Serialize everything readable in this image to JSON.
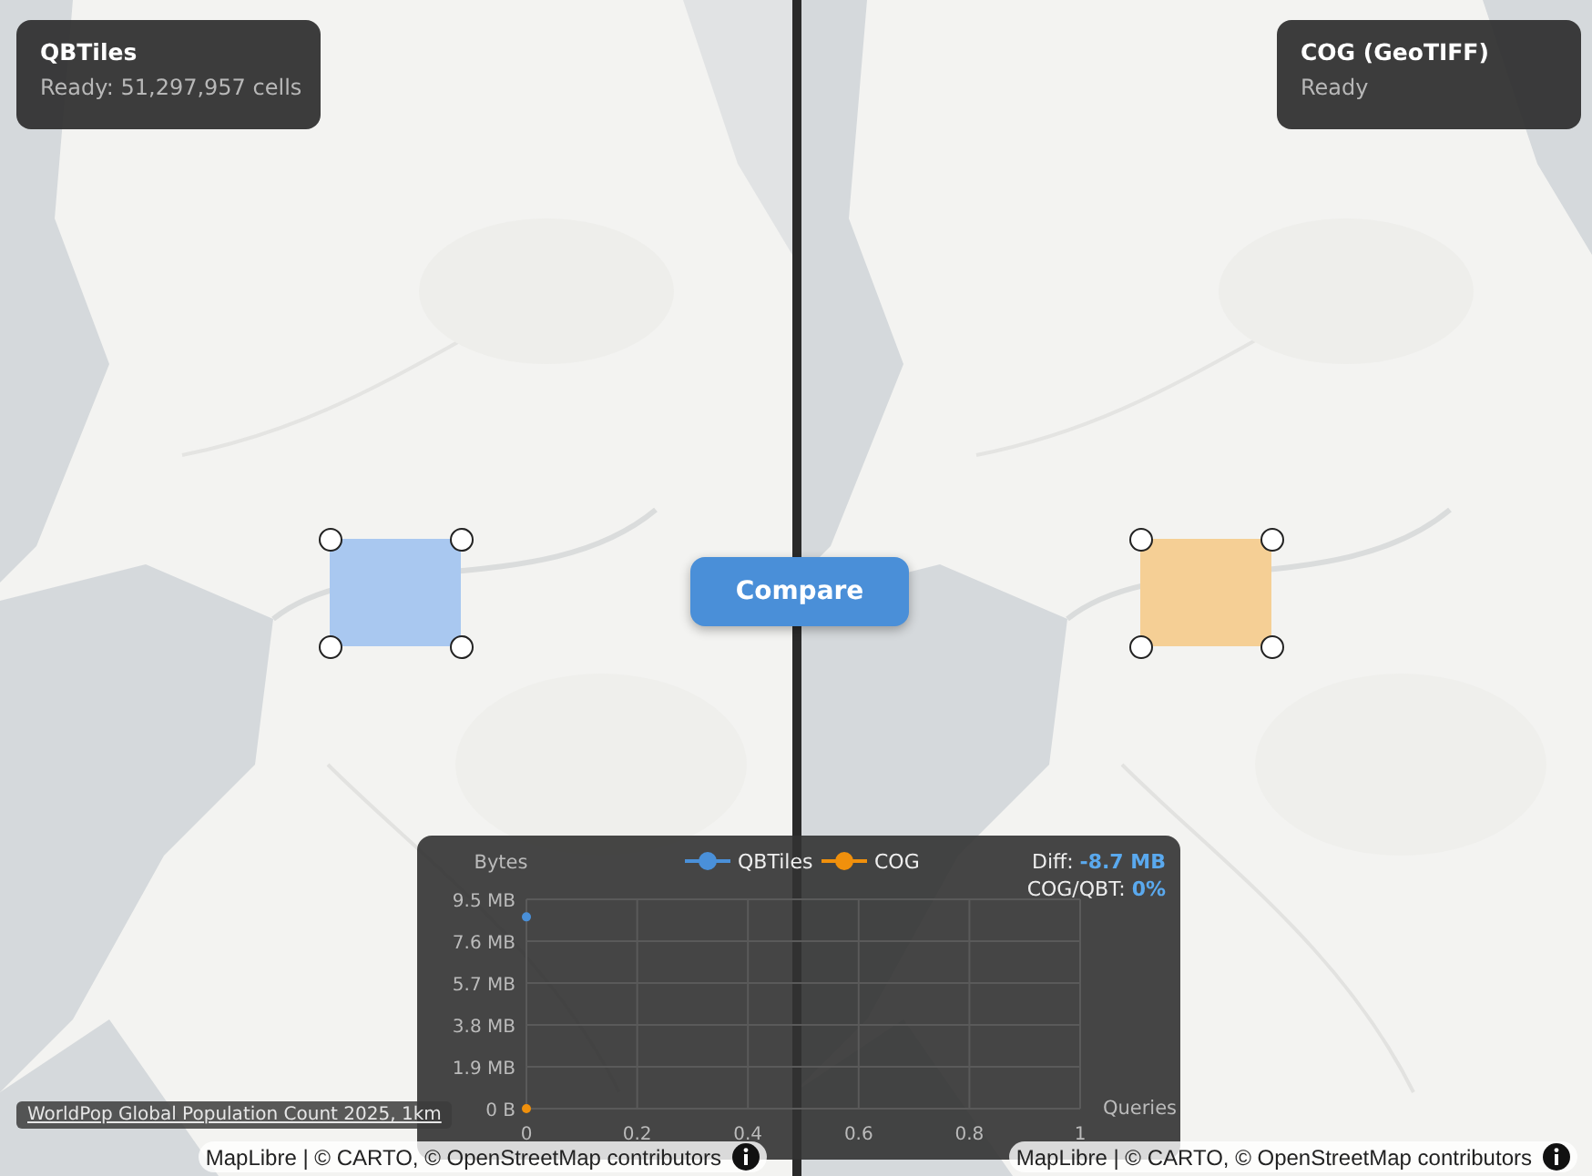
{
  "panes": [
    {
      "title": "QBTiles",
      "status": "Ready: 51,297,957 cells",
      "selection": {
        "color": "#a9c8f0"
      },
      "attribution": "MapLibre | © CARTO, © OpenStreetMap contributors"
    },
    {
      "title": "COG (GeoTIFF)",
      "status": "Ready",
      "selection": {
        "color": "#f5cf95"
      },
      "attribution": "MapLibre | © CARTO, © OpenStreetMap contributors"
    }
  ],
  "compare_button": "Compare",
  "source_link": "WorldPop Global Population Count 2025, 1km",
  "chart": {
    "stats": {
      "diff_label": "Diff:",
      "diff_value": "-8.7 MB",
      "ratio_label": "COG/QBT:",
      "ratio_value": "0%"
    },
    "chart_data": {
      "type": "line",
      "xlabel": "Queries",
      "ylabel": "Bytes",
      "x": [
        0
      ],
      "series": [
        {
          "name": "QBTiles",
          "color": "#4a90d9",
          "marker": "circle",
          "values": [
            8.7
          ]
        },
        {
          "name": "COG",
          "color": "#f0900c",
          "marker": "circle",
          "values": [
            0
          ]
        }
      ],
      "grid": true,
      "legend": "top",
      "xlim": [
        0,
        1
      ],
      "ylim": [
        0,
        9.5
      ],
      "xticks": [
        0,
        0.2,
        0.4,
        0.6,
        0.8,
        1
      ],
      "yticks": [
        {
          "value": 0,
          "label": "0 B"
        },
        {
          "value": 1.9,
          "label": "1.9 MB"
        },
        {
          "value": 3.8,
          "label": "3.8 MB"
        },
        {
          "value": 5.7,
          "label": "5.7 MB"
        },
        {
          "value": 7.6,
          "label": "7.6 MB"
        },
        {
          "value": 9.5,
          "label": "9.5 MB"
        }
      ]
    }
  }
}
